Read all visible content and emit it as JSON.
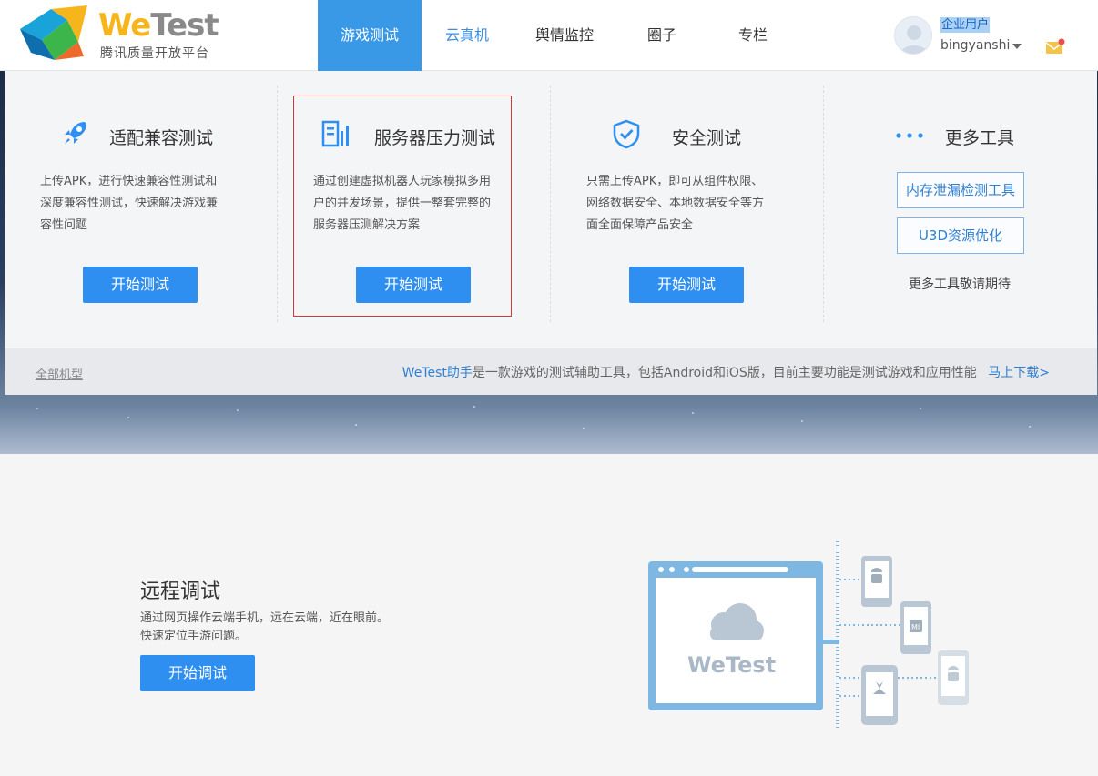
{
  "header": {
    "logo_we": "We",
    "logo_test": "Test",
    "logo_subtitle": "腾讯质量开放平台",
    "nav": [
      {
        "label": "游戏测试",
        "active": true
      },
      {
        "label": "云真机",
        "active": false
      },
      {
        "label": "舆情监控",
        "active": false
      },
      {
        "label": "圈子",
        "active": false
      },
      {
        "label": "专栏",
        "active": false
      }
    ],
    "user_role": "企业用户",
    "user_name": "bingyanshi"
  },
  "panel": {
    "compat": {
      "title": "适配兼容测试",
      "desc": [
        "上传APK，进行快速兼容性测试和",
        "深度兼容性测试，快速解决游戏兼",
        "容性问题"
      ],
      "button": "开始测试"
    },
    "stress": {
      "title": "服务器压力测试",
      "desc": [
        "通过创建虚拟机器人玩家模拟多用",
        "户的并发场景，提供一整套完整的",
        "服务器压测解决方案"
      ],
      "button": "开始测试"
    },
    "security": {
      "title": "安全测试",
      "desc": [
        "只需上传APK，即可从组件权限、",
        "网络数据安全、本地数据安全等方",
        "面全面保障产品安全"
      ],
      "button": "开始测试"
    },
    "more": {
      "title": "更多工具",
      "tools": [
        "内存泄漏检测工具",
        "U3D资源优化"
      ],
      "note": "更多工具敬请期待"
    },
    "footer": {
      "all_models": "全部机型",
      "helper_name": "WeTest助手",
      "helper_desc": "是一款游戏的测试辅助工具，包括Android和iOS版，目前主要功能是测试游戏和应用性能",
      "download": "马上下载>"
    }
  },
  "remote": {
    "title": "远程调试",
    "desc": [
      "通过网页操作云端手机，远在云端，近在眼前。",
      "快速定位手游问题。"
    ],
    "button": "开始调试",
    "illustration_brand": "WeTest",
    "phone_brand": "MI"
  },
  "colors": {
    "primary": "#2f8ff0",
    "nav_active": "#3a99e6",
    "logo_yellow": "#f7b51c",
    "highlight_border": "#d23a3a"
  },
  "icons": [
    "rocket-icon",
    "server-icon",
    "shield-check-icon",
    "more-dots-icon",
    "mail-icon",
    "avatar-icon",
    "caret-down-icon",
    "cloud-icon",
    "android-icon",
    "huawei-icon"
  ]
}
